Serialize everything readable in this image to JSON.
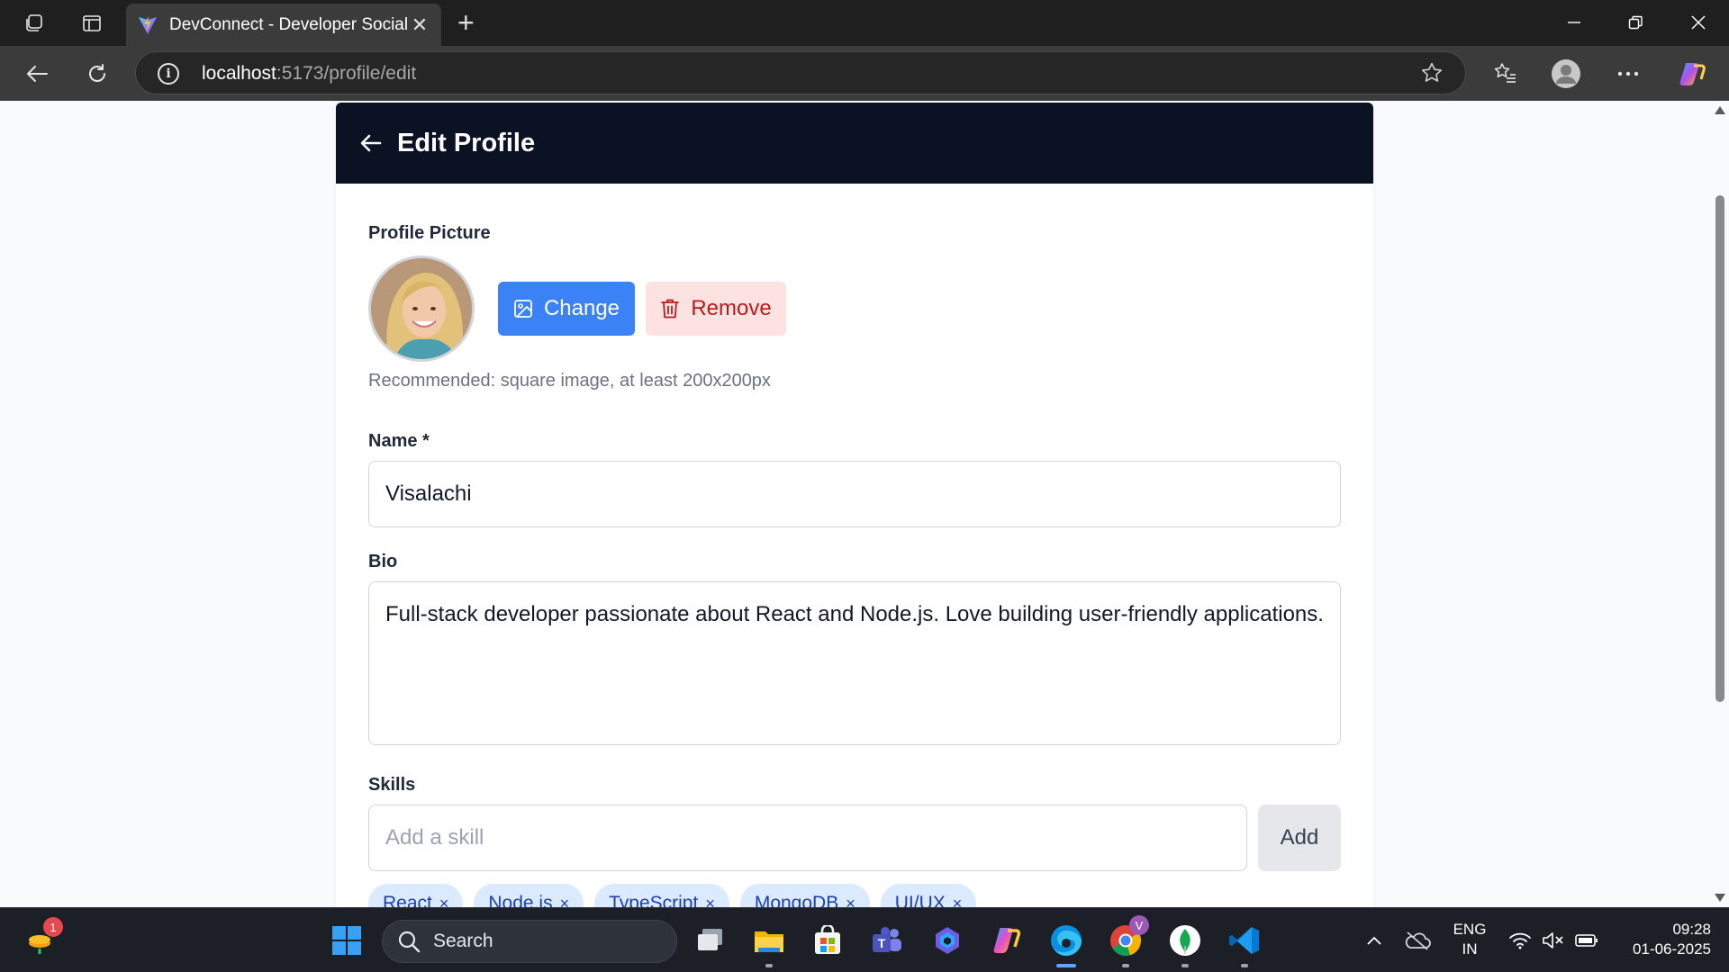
{
  "browser": {
    "tab_title": "DevConnect - Developer Social Network",
    "url_host": "localhost",
    "url_path": ":5173/profile/edit"
  },
  "page": {
    "header_title": "Edit Profile",
    "profile_picture_label": "Profile Picture",
    "change_label": "Change",
    "remove_label": "Remove",
    "picture_hint": "Recommended: square image, at least 200x200px",
    "name_label": "Name",
    "name_required_mark": "*",
    "name_value": "Visalachi",
    "bio_label": "Bio",
    "bio_value": "Full-stack developer passionate about React and Node.js. Love building user-friendly applications.",
    "skills_label": "Skills",
    "skill_placeholder": "Add a skill",
    "add_label": "Add",
    "skills": [
      "React",
      "Node.js",
      "TypeScript",
      "MongoDB",
      "UI/UX"
    ],
    "chip_remove_glyph": "×"
  },
  "taskbar": {
    "search_label": "Search",
    "notification_count": "1",
    "language_line1": "ENG",
    "language_line2": "IN",
    "time": "09:28",
    "date": "01-06-2025",
    "chrome_profile_letter": "V"
  }
}
